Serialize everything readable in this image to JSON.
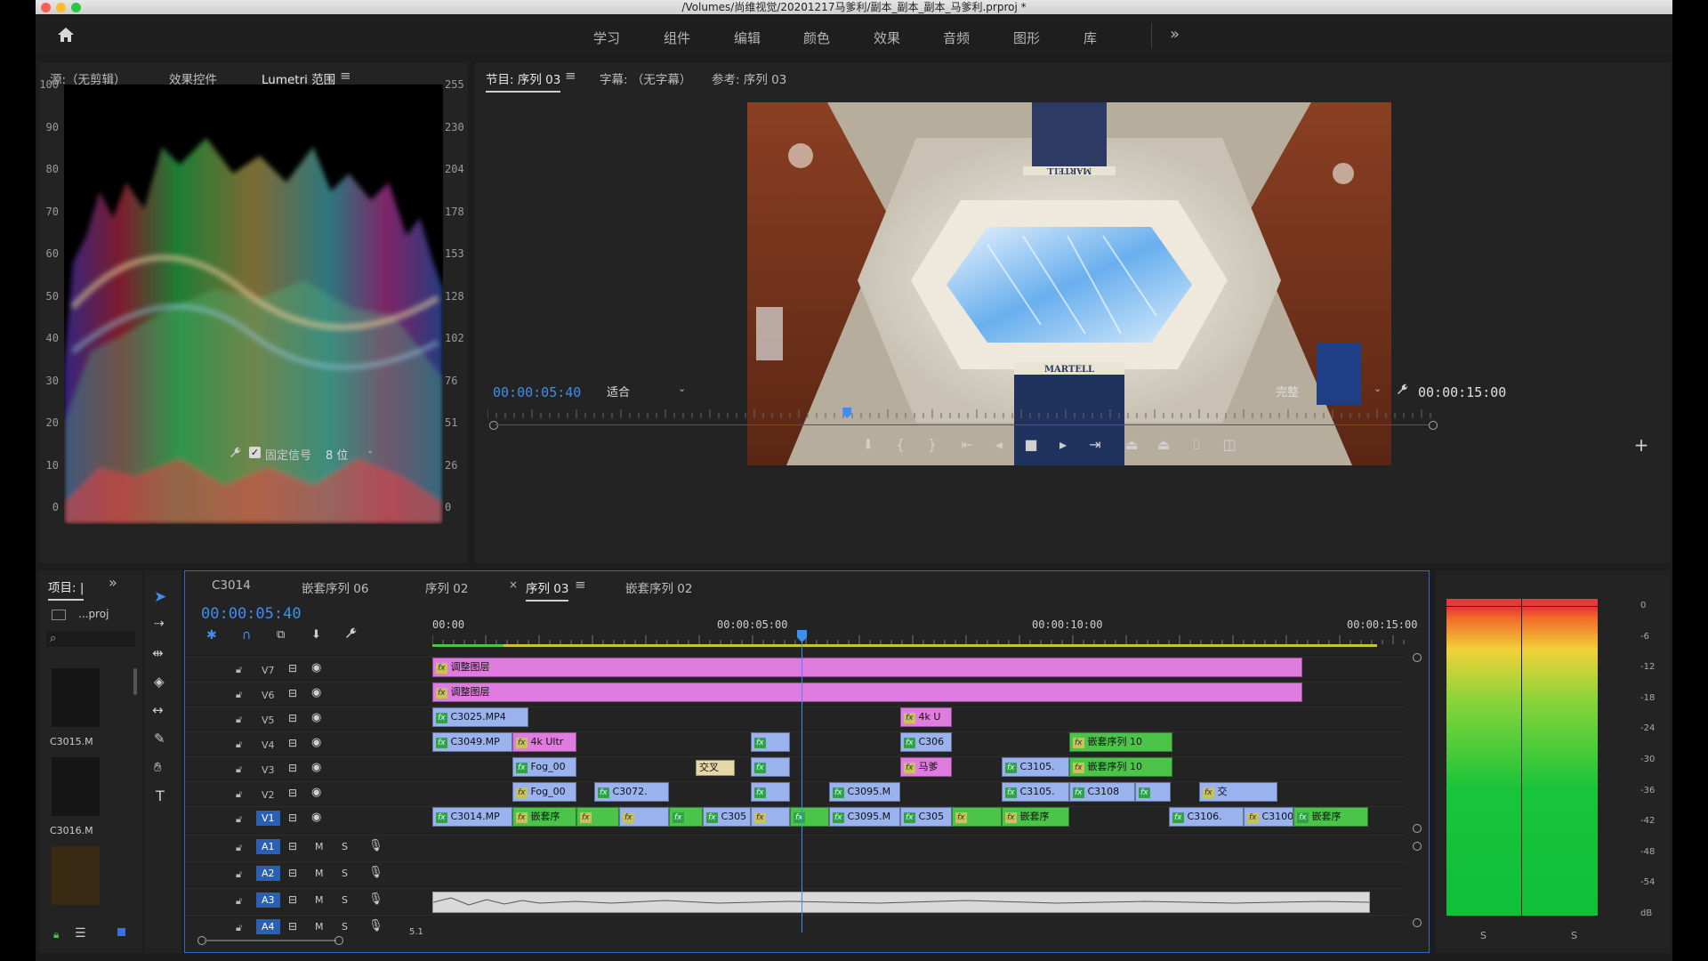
{
  "window": {
    "title": "/Volumes/尚维视觉/20201217马爹利/副本_副本_副本_马爹利.prproj *"
  },
  "nav": {
    "items": [
      "学习",
      "组件",
      "编辑",
      "颜色",
      "效果",
      "音频",
      "图形",
      "库"
    ],
    "more": "»"
  },
  "source_panel": {
    "tabs": [
      "源:（无剪辑）",
      "效果控件",
      "Lumetri 范围"
    ],
    "active_tab": "Lumetri 范围",
    "left_axis": [
      "100",
      "90",
      "80",
      "70",
      "60",
      "50",
      "40",
      "30",
      "20",
      "10",
      "0"
    ],
    "right_axis": [
      "255",
      "230",
      "204",
      "178",
      "153",
      "128",
      "102",
      "76",
      "51",
      "26",
      "0"
    ],
    "clamp_label": "固定信号",
    "clamp_checked": true,
    "bit_depth": "8 位"
  },
  "program_panel": {
    "tabs": [
      "节目: 序列 03",
      "字幕: （无字幕）",
      "参考: 序列 03"
    ],
    "active_tab": "节目: 序列 03",
    "current_time": "00:00:05:40",
    "fit": "适合",
    "quality": "完整",
    "duration": "00:00:15:00",
    "playhead_fraction": 0.38
  },
  "project_panel": {
    "tab": "项目: |",
    "proj_label": "...proj",
    "items": [
      "C3015.M",
      "C3016.M"
    ]
  },
  "timeline": {
    "tabs": [
      "C3014",
      "嵌套序列 06",
      "序列 02",
      "序列 03",
      "嵌套序列 02"
    ],
    "active_tab": "序列 03",
    "current_time": "00:00:05:40",
    "ruler": [
      "00:00",
      "00:00:05:00",
      "00:00:10:00",
      "00:00:15:00"
    ],
    "tracks": {
      "video": [
        "V7",
        "V6",
        "V5",
        "V4",
        "V3",
        "V2",
        "V1"
      ],
      "audio": [
        "A1",
        "A2",
        "A3",
        "A4"
      ],
      "mute": "M",
      "solo": "S",
      "a4_value": "5.1"
    },
    "clips": {
      "adj1": "调整图层",
      "adj2": "调整图层",
      "v5a": "C3025.MP4",
      "v5b": "4k U",
      "v4a": "C3049.MP",
      "v4b": "4k Ultr",
      "v4c": "C306",
      "v4d": "嵌套序列 10",
      "v3a": "Fog_00",
      "v3b": "交叉",
      "v3c": "马爹",
      "v3d": "C3105.",
      "v3e": "嵌套序列 10",
      "v2a": "Fog_00",
      "v2b": "C3072.",
      "v2c": "C3095.M",
      "v2d": "C3105.",
      "v2e": "C3108",
      "v2f": "交",
      "v1a": "C3014.MP",
      "v1b": "嵌套序",
      "v1c": "C305",
      "v1d": "C3095.M",
      "v1e": "C305",
      "v1f": "嵌套序",
      "v1g": "C3106.",
      "v1h": "C3100",
      "v1i": "嵌套序"
    }
  },
  "meter": {
    "db_scale": [
      "0",
      "-6",
      "-12",
      "-18",
      "-24",
      "-30",
      "-36",
      "-42",
      "-48",
      "-54",
      "dB"
    ],
    "solo_left": "S",
    "solo_right": "S"
  },
  "colors": {
    "accent": "#3e8ef0",
    "adjustment": "#e07ce0",
    "clip_blue": "#9ab2ee",
    "clip_green": "#4cc44a"
  }
}
